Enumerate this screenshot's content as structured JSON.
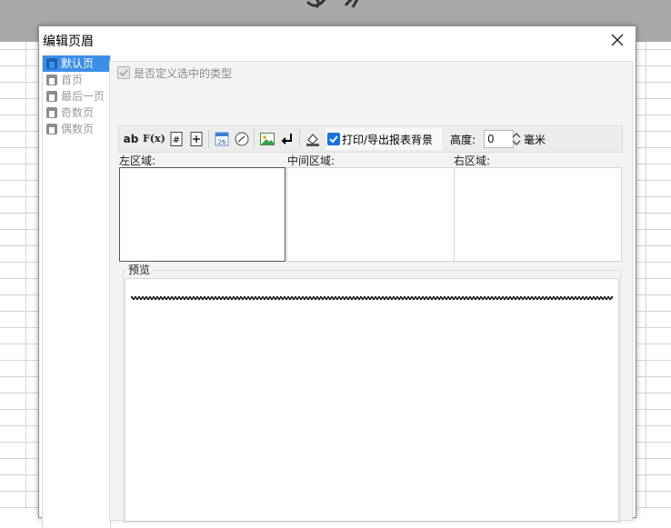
{
  "dialog": {
    "title": "编辑页眉"
  },
  "nav": {
    "items": [
      {
        "label": "默认页",
        "active": true
      },
      {
        "label": "首页",
        "active": false
      },
      {
        "label": "最后一页",
        "active": false
      },
      {
        "label": "奇数页",
        "active": false
      },
      {
        "label": "偶数页",
        "active": false
      }
    ]
  },
  "custom_type": {
    "label": "是否定义选中的类型",
    "checked": true,
    "enabled": false
  },
  "toolbar": {
    "text_icon": "ab",
    "formula_icon": "F(x)",
    "print_bg_label": "打印/导出报表背景",
    "print_bg_checked": true,
    "height_label": "高度:",
    "height_value": "0",
    "unit_label": "毫米",
    "icons": [
      "text-icon",
      "formula-icon",
      "page-number-icon",
      "total-pages-icon",
      "date-icon",
      "time-icon",
      "image-icon",
      "newline-icon",
      "background-fill-icon"
    ]
  },
  "regions": {
    "left": "左区域:",
    "center": "中间区域:",
    "right": "右区域:"
  },
  "preview": {
    "label": "预览"
  },
  "colors": {
    "accent": "#3d8ee6",
    "checkbox_blue": "#1a73d9"
  }
}
